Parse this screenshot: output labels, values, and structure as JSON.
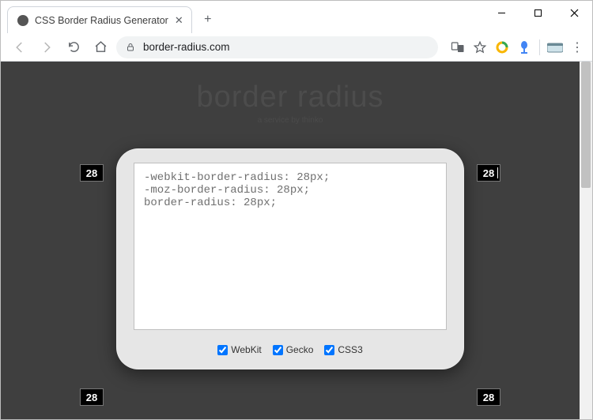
{
  "window": {
    "tab_title": "CSS Border Radius Generator",
    "url_display": "border-radius.com"
  },
  "page": {
    "title": "border radius",
    "subtitle": "a service by thinko"
  },
  "radius": {
    "tl": "28",
    "tr": "28",
    "bl": "28",
    "br": "28"
  },
  "code_lines": [
    "-webkit-border-radius: 28px;",
    "-moz-border-radius: 28px;",
    "border-radius: 28px;"
  ],
  "options": {
    "webkit": {
      "label": "WebKit",
      "checked": true
    },
    "gecko": {
      "label": "Gecko",
      "checked": true
    },
    "css3": {
      "label": "CSS3",
      "checked": true
    }
  }
}
